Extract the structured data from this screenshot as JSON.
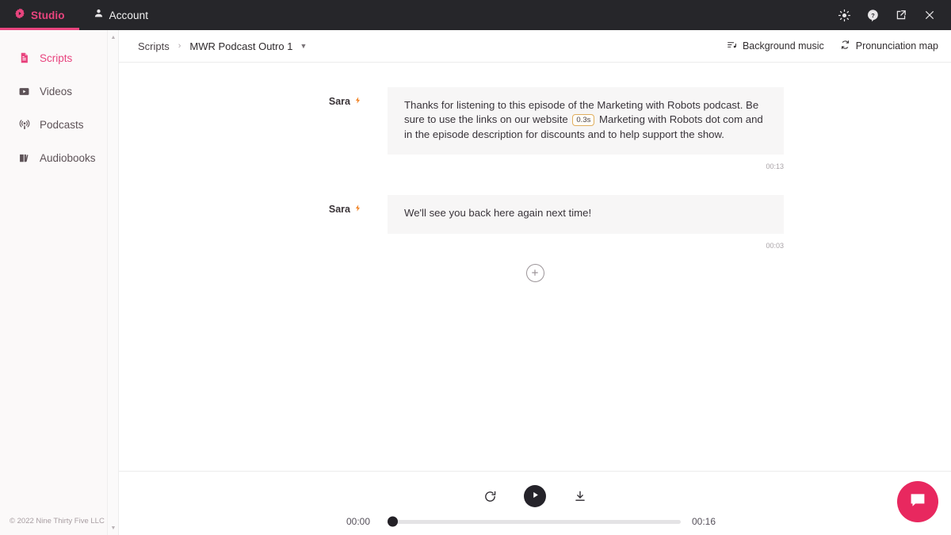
{
  "topbar": {
    "brand": "Studio",
    "brand_icon": "gear-play-icon",
    "account": "Account",
    "account_icon": "person-icon",
    "window_buttons": [
      {
        "name": "brightness-icon",
        "label": "Brightness"
      },
      {
        "name": "help-icon",
        "label": "Help"
      },
      {
        "name": "external-link-icon",
        "label": "Open external"
      },
      {
        "name": "close-icon",
        "label": "Close"
      }
    ],
    "accent_color": "#e8447e",
    "background_color": "#26262a"
  },
  "sidebar": {
    "items": [
      {
        "label": "Scripts",
        "icon": "document-icon",
        "active": true
      },
      {
        "label": "Videos",
        "icon": "video-icon",
        "active": false
      },
      {
        "label": "Podcasts",
        "icon": "podcast-icon",
        "active": false
      },
      {
        "label": "Audiobooks",
        "icon": "book-icon",
        "active": false
      }
    ],
    "footer": "© 2022 Nine Thirty Five LLC"
  },
  "header": {
    "breadcrumb_root": "Scripts",
    "breadcrumb_separator": "›",
    "breadcrumb_current": "MWR Podcast Outro 1",
    "caret_icon": "chevron-down-icon",
    "actions": [
      {
        "label": "Background music",
        "icon": "music-lines-icon"
      },
      {
        "label": "Pronunciation map",
        "icon": "refresh-icon"
      }
    ]
  },
  "script_blocks": [
    {
      "speaker": "Sara",
      "speaker_icon": "lightning-bolt-icon",
      "text_before": "Thanks for listening to this episode of the Marketing with Robots podcast. Be sure to use the links on our website",
      "pause": "0.3s",
      "text_after": "Marketing with Robots dot com and in the episode description for discounts and to help support the show.",
      "duration": "00:13"
    },
    {
      "speaker": "Sara",
      "speaker_icon": "lightning-bolt-icon",
      "text_before": "We'll see you back here again next time!",
      "pause": null,
      "text_after": "",
      "duration": "00:03"
    }
  ],
  "add_block": {
    "icon": "plus-circle-icon",
    "label": "Add block"
  },
  "player": {
    "restart_icon": "restart-icon",
    "play_icon": "play-icon",
    "download_icon": "download-icon",
    "current_time": "00:00",
    "total_time": "00:16",
    "progress_percent": 0
  },
  "chat_widget": {
    "icon": "chat-bubble-icon",
    "color": "#e8285f"
  }
}
